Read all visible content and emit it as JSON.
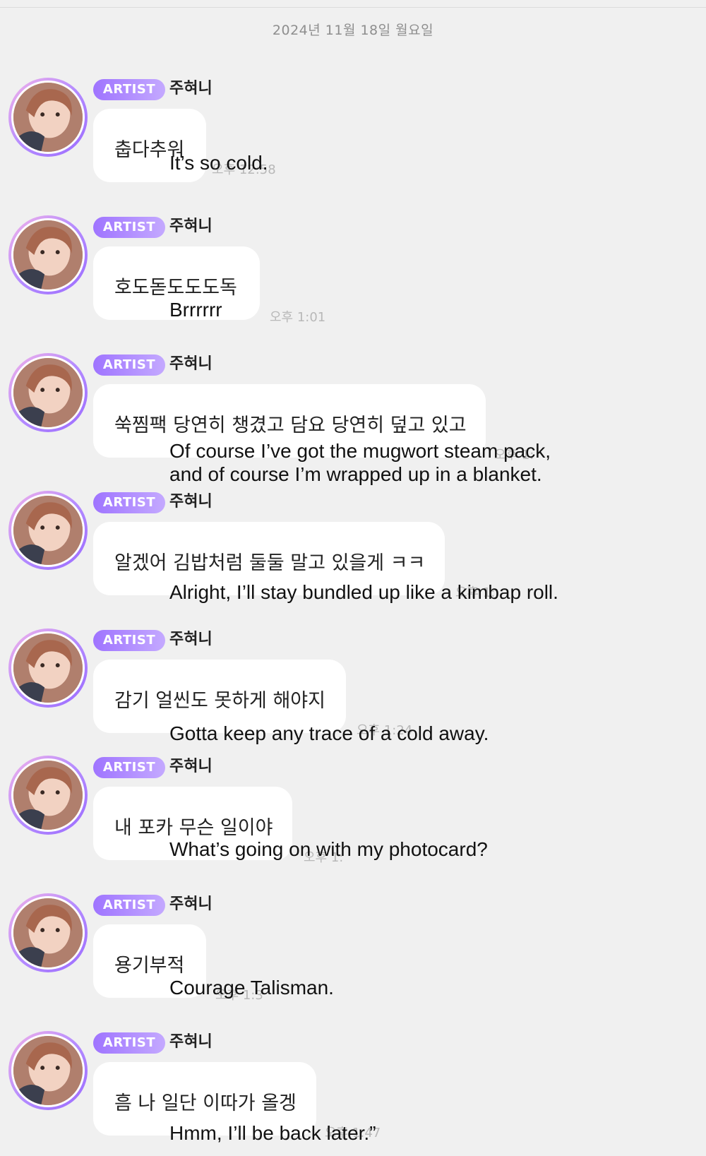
{
  "date_header": "2024년 11월 18일 월요일",
  "messages": [
    {
      "badge": "ARTIST",
      "sender": "주혀니",
      "ko": "춥다추워",
      "time": "오후 12:58",
      "en1": "It’s so cold.",
      "en2": ""
    },
    {
      "badge": "ARTIST",
      "sender": "주혀니",
      "ko": "호도돋도도도독",
      "time": "오후 1:01",
      "en1": "Brrrrrr",
      "en2": ""
    },
    {
      "badge": "ARTIST",
      "sender": "주혀니",
      "ko": "쑥찜팩 당연히 챙겼고 담요 당연히 덮고 있고",
      "time": "오후 1:",
      "en1": "Of course I’ve got the mugwort steam pack,",
      "en2": "and of course I’m wrapped up in a blanket."
    },
    {
      "badge": "ARTIST",
      "sender": "주혀니",
      "ko": "알겠어 김밥처럼 둘둘 말고 있을게 ㅋㅋ",
      "time": "오후 1:",
      "en1": "Alright, I’ll stay bundled up like a kimbap roll.",
      "en2": ""
    },
    {
      "badge": "ARTIST",
      "sender": "주혀니",
      "ko": "감기 얼씬도 못하게 해야지",
      "time": "오후 1:24",
      "en1": "Gotta keep any trace of a cold away.",
      "en2": ""
    },
    {
      "badge": "ARTIST",
      "sender": "주혀니",
      "ko": "내 포카 무슨 일이야",
      "time": "오후 1:",
      "en1": "What’s going on with my photocard?",
      "en2": ""
    },
    {
      "badge": "ARTIST",
      "sender": "주혀니",
      "ko": "용기부적",
      "time": "오후 1:3",
      "en1": "Courage Talisman.",
      "en2": ""
    },
    {
      "badge": "ARTIST",
      "sender": "주혀니",
      "ko": "흠 나 일단 이따가 올겡",
      "time": "오후 1:47",
      "en1": "Hmm, I’ll be back later.”",
      "en2": ""
    }
  ]
}
